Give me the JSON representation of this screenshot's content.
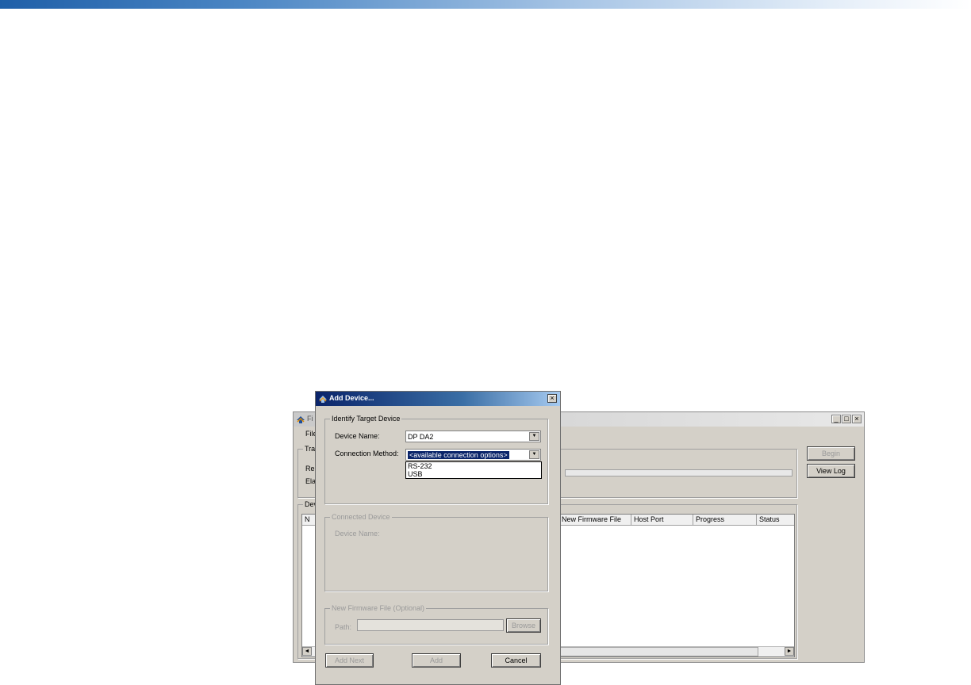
{
  "main_window": {
    "title": "Fi",
    "controls": {
      "minimize": "_",
      "maximize": "□",
      "close": "×"
    },
    "menu": {
      "file": "File"
    },
    "transfer_group": {
      "label": "Tra",
      "row1": "Re",
      "row2": "Ela"
    },
    "buttons": {
      "begin": "Begin",
      "view_log": "View Log"
    },
    "device_group": {
      "label": "Dev"
    },
    "table": {
      "columns": [
        "N",
        "New Firmware File",
        "Host Port",
        "Progress",
        "Status"
      ]
    },
    "scroll": {
      "left": "◄",
      "right": "►"
    }
  },
  "dialog": {
    "title": "Add Device...",
    "close": "×",
    "identify_group": {
      "label": "Identify Target Device",
      "device_name_label": "Device Name:",
      "device_name_value": "DP DA2",
      "connection_label": "Connection Method:",
      "connection_value": "<available connection options>",
      "options": [
        "RS-232",
        "USB"
      ]
    },
    "connected_group": {
      "label": "Connected Device",
      "device_name_label": "Device Name:"
    },
    "firmware_group": {
      "label": "New Firmware File (Optional)",
      "path_label": "Path:",
      "browse": "Browse"
    },
    "buttons": {
      "add_next": "Add Next",
      "add": "Add",
      "cancel": "Cancel"
    }
  },
  "colors": {
    "title_active": "#0a246a",
    "selection": "#0a246a",
    "face": "#d4d0c8"
  }
}
